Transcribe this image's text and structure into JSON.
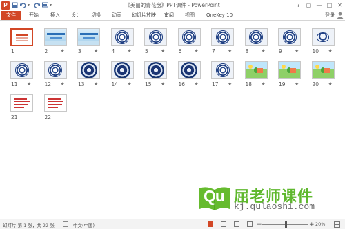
{
  "titlebar": {
    "app_icon": "P",
    "title": "《美丽的青花盘》PPT课件 - PowerPoint",
    "qat_icons": [
      "save-icon",
      "undo-icon",
      "redo-icon",
      "repeat-icon"
    ],
    "window_controls": [
      "?",
      "▢",
      "—",
      "□",
      "✕"
    ]
  },
  "ribbon": {
    "file_tab": "文件",
    "tabs": [
      "开始",
      "插入",
      "设计",
      "切换",
      "动画",
      "幻灯片放映",
      "审阅",
      "视图",
      "OneKey 10"
    ],
    "login": "登录",
    "accent": "#d24726"
  },
  "slides": [
    {
      "num": "1",
      "style": "white",
      "star": ""
    },
    {
      "num": "2",
      "style": "blue",
      "star": "★"
    },
    {
      "num": "3",
      "style": "blue",
      "star": "★"
    },
    {
      "num": "4",
      "style": "plate",
      "star": "★"
    },
    {
      "num": "5",
      "style": "plate",
      "star": "★"
    },
    {
      "num": "6",
      "style": "plate",
      "star": "★"
    },
    {
      "num": "7",
      "style": "plate",
      "star": "★"
    },
    {
      "num": "8",
      "style": "plate",
      "star": "★"
    },
    {
      "num": "9",
      "style": "plate",
      "star": "★"
    },
    {
      "num": "10",
      "style": "bowl",
      "star": "★"
    },
    {
      "num": "11",
      "style": "plate",
      "star": "★"
    },
    {
      "num": "12",
      "style": "plate",
      "star": "★"
    },
    {
      "num": "13",
      "style": "dark",
      "star": "★"
    },
    {
      "num": "14",
      "style": "dark",
      "star": "★"
    },
    {
      "num": "15",
      "style": "dark",
      "star": "★"
    },
    {
      "num": "16",
      "style": "dark",
      "star": "★"
    },
    {
      "num": "17",
      "style": "plate",
      "star": "★"
    },
    {
      "num": "18",
      "style": "scene",
      "star": "★"
    },
    {
      "num": "19",
      "style": "scene",
      "star": "★"
    },
    {
      "num": "20",
      "style": "scene",
      "star": "★"
    },
    {
      "num": "21",
      "style": "text",
      "star": ""
    },
    {
      "num": "22",
      "style": "text",
      "star": ""
    }
  ],
  "selected_slide": "1",
  "watermark": {
    "logo_text": "Qu",
    "name": "屈老师课件",
    "url": "kj.qulaoshi.com"
  },
  "status": {
    "slide_info": "幻灯片 第 1 张，共 22 张",
    "language": "中文(中国)",
    "zoom_minus": "−",
    "zoom_plus": "+",
    "zoom_level": "20%",
    "zoom_fraction": 0.2
  }
}
